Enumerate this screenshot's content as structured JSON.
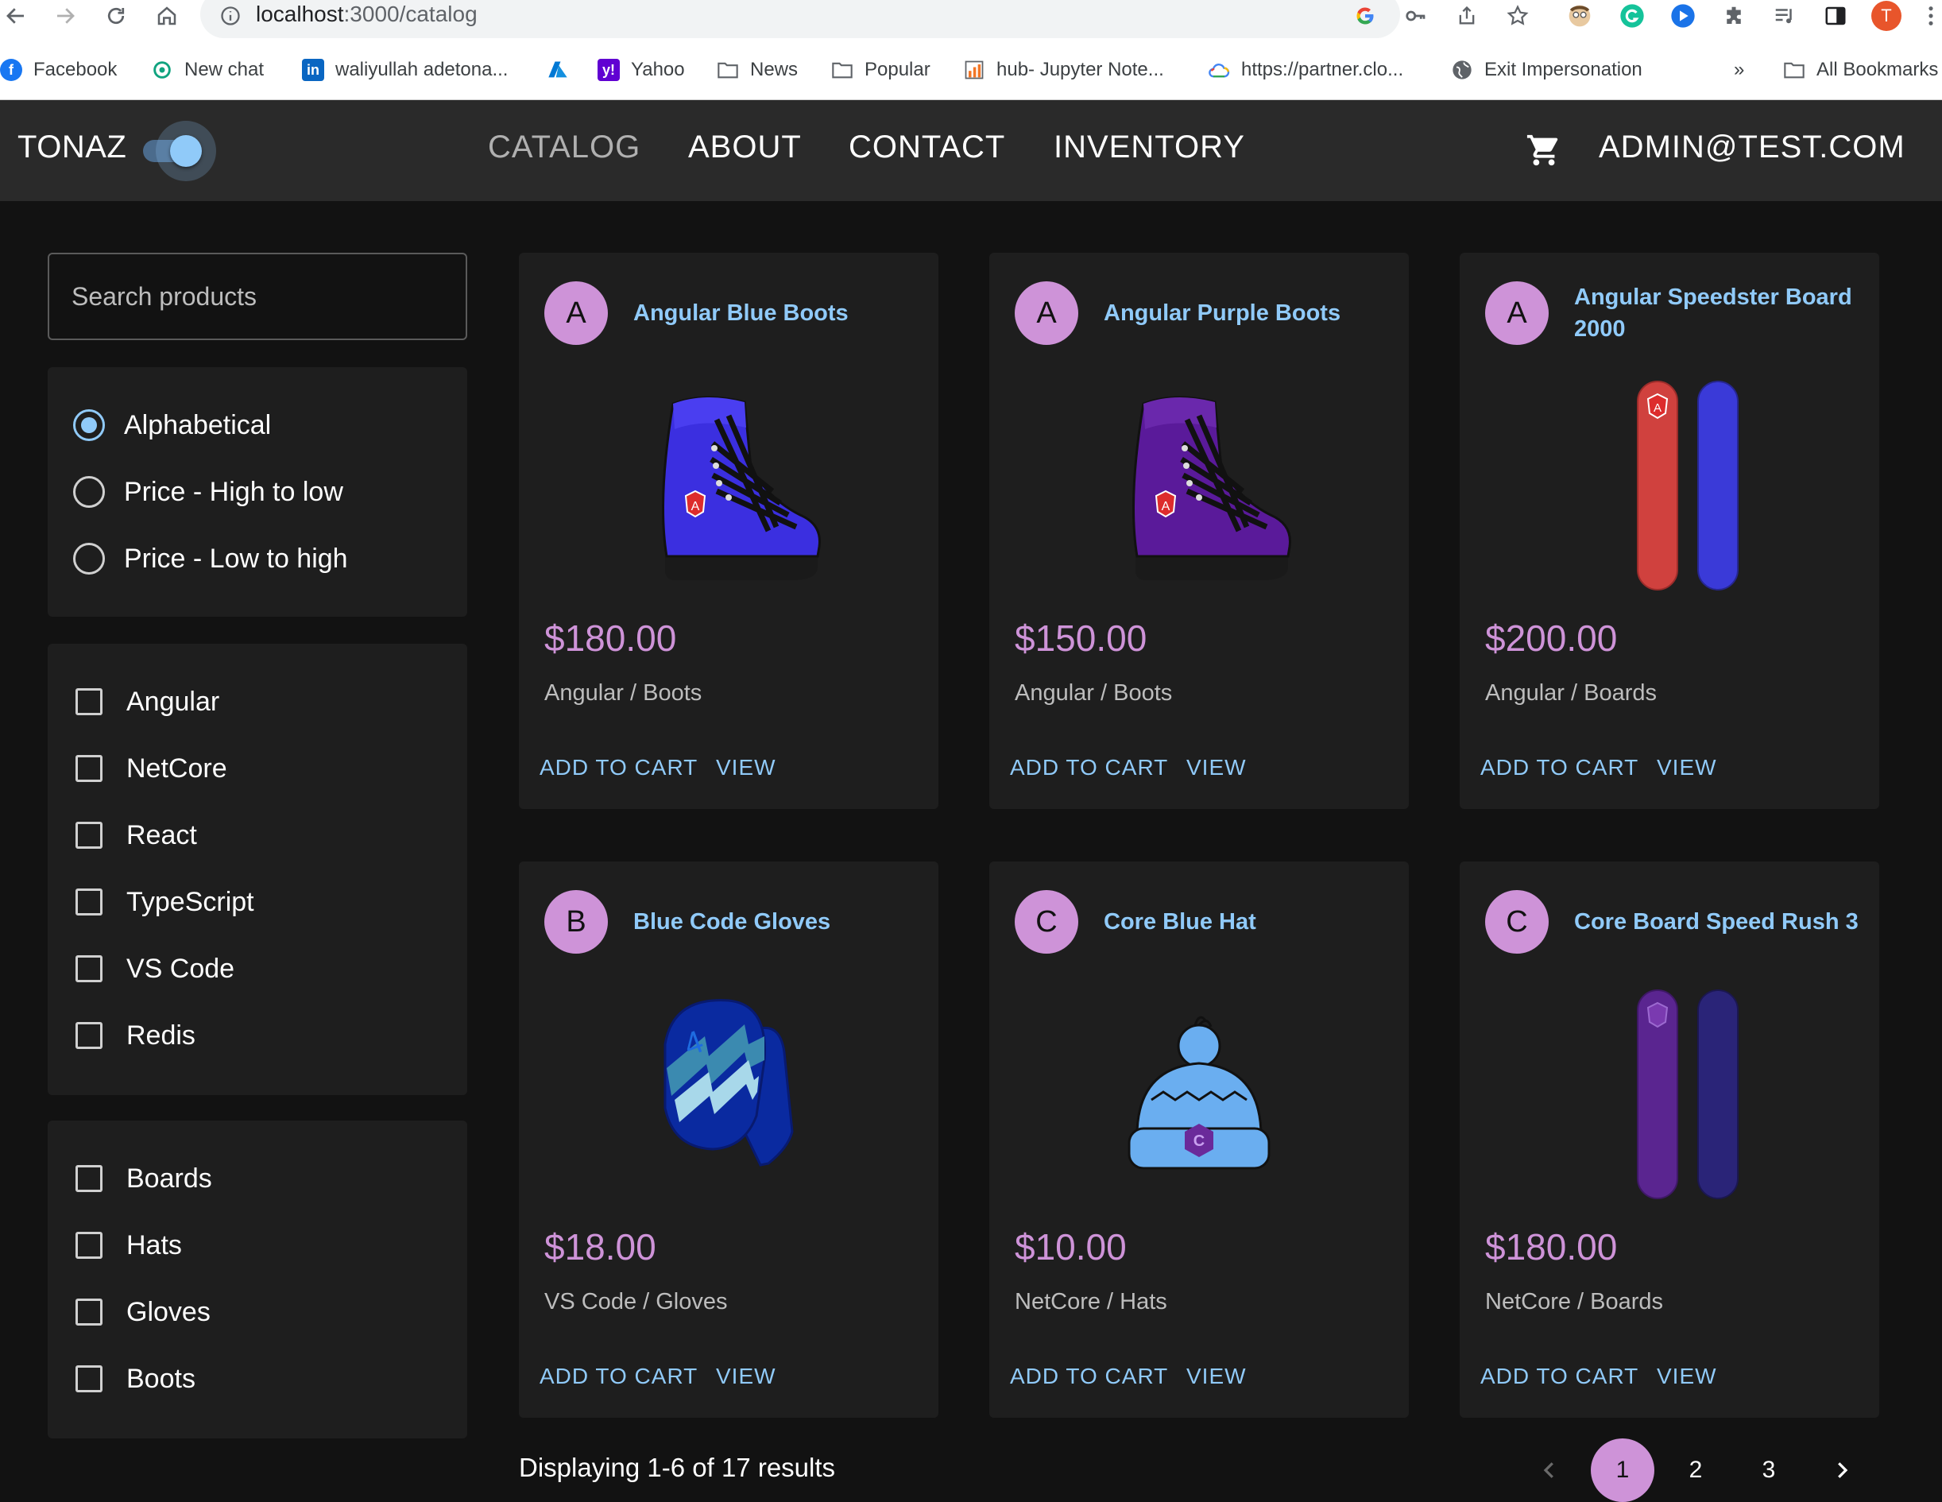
{
  "browser": {
    "url_host": "localhost",
    "url_path": ":3000/catalog",
    "profile_initial": "T",
    "bookmarks": [
      {
        "label": "Facebook",
        "icon": "facebook-icon"
      },
      {
        "label": "New chat",
        "icon": "openai-icon"
      },
      {
        "label": "waliyullah adetona...",
        "icon": "linkedin-icon"
      },
      {
        "label": "",
        "icon": "azure-icon"
      },
      {
        "label": "Yahoo",
        "icon": "yahoo-icon"
      },
      {
        "label": "News",
        "icon": "folder-icon"
      },
      {
        "label": "Popular",
        "icon": "folder-icon"
      },
      {
        "label": "hub- Jupyter Note...",
        "icon": "chart-icon"
      },
      {
        "label": "https://partner.clo...",
        "icon": "cloud-icon"
      },
      {
        "label": "Exit Impersonation",
        "icon": "globe-icon"
      }
    ],
    "more_bookmarks": "»",
    "all_bookmarks": "All Bookmarks"
  },
  "app": {
    "brand": "TONAZ",
    "nav": [
      "CATALOG",
      "ABOUT",
      "CONTACT",
      "INVENTORY"
    ],
    "user_email": "ADMIN@TEST.COM"
  },
  "sidebar": {
    "search_placeholder": "Search products",
    "sort_options": [
      "Alphabetical",
      "Price - High to low",
      "Price - Low to high"
    ],
    "selected_sort": "Alphabetical",
    "brands": [
      "Angular",
      "NetCore",
      "React",
      "TypeScript",
      "VS Code",
      "Redis"
    ],
    "types": [
      "Boards",
      "Hats",
      "Gloves",
      "Boots"
    ]
  },
  "products": [
    {
      "initial": "A",
      "name": "Angular Blue Boots",
      "price": "$180.00",
      "category": "Angular / Boots",
      "image": "boot-icon",
      "color": "#3b2fe0"
    },
    {
      "initial": "A",
      "name": "Angular Purple Boots",
      "price": "$150.00",
      "category": "Angular / Boots",
      "image": "boot-icon",
      "color": "#5a1a9a"
    },
    {
      "initial": "A",
      "name": "Angular Speedster Board 2000",
      "price": "$200.00",
      "category": "Angular / Boards",
      "image": "snowboard-icon",
      "color": "#d0413e"
    },
    {
      "initial": "B",
      "name": "Blue Code Gloves",
      "price": "$18.00",
      "category": "VS Code / Gloves",
      "image": "glove-icon",
      "color": "#0a2aa0"
    },
    {
      "initial": "C",
      "name": "Core Blue Hat",
      "price": "$10.00",
      "category": "NetCore / Hats",
      "image": "hat-icon",
      "color": "#6aaef0"
    },
    {
      "initial": "C",
      "name": "Core Board Speed Rush 3",
      "price": "$180.00",
      "category": "NetCore / Boards",
      "image": "snowboard-icon",
      "color": "#5a2590"
    }
  ],
  "card_actions": {
    "add": "ADD TO CART",
    "view": "VIEW"
  },
  "results_text": "Displaying 1-6 of 17 results",
  "pagination": {
    "pages": [
      "1",
      "2",
      "3"
    ],
    "current": "1"
  },
  "colors": {
    "accent": "#90caf9",
    "secondary": "#ce93d8",
    "background": "#121212",
    "paper": "#1e1e1e",
    "appbar": "#2a2a2a"
  }
}
